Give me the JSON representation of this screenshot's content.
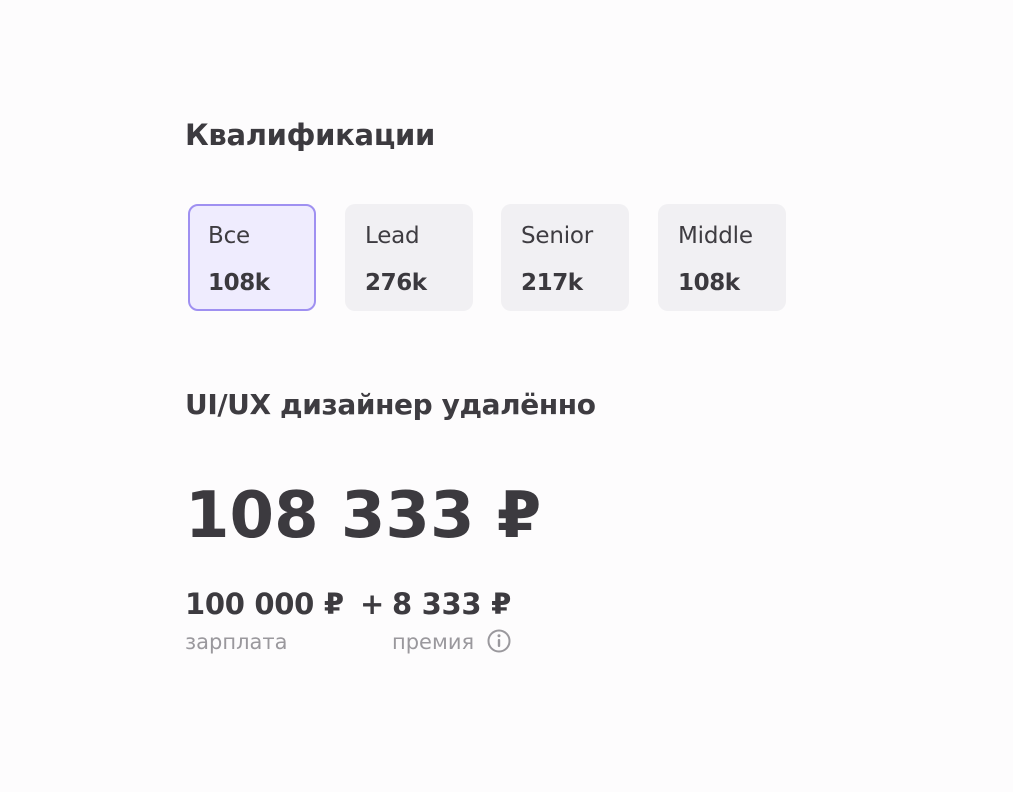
{
  "qualifications": {
    "title": "Квалификации",
    "tabs": [
      {
        "label": "Все",
        "value": "108k",
        "active": true
      },
      {
        "label": "Lead",
        "value": "276k",
        "active": false
      },
      {
        "label": "Senior",
        "value": "217k",
        "active": false
      },
      {
        "label": "Middle",
        "value": "108k",
        "active": false
      }
    ]
  },
  "job": {
    "title": "UI/UX дизайнер удалённо",
    "total": "108 333 ₽",
    "salary_amount": "100 000 ₽",
    "plus": "+",
    "bonus_amount": "8 333 ₽",
    "salary_label": "зарплата",
    "bonus_label": "премия"
  },
  "icons": {
    "info": "info-icon"
  },
  "colors": {
    "accent_border": "#9f90f1",
    "accent_background": "#efecfe",
    "tab_background": "#f1f0f3",
    "text_primary": "#3c3a3f",
    "text_muted": "#9a989d"
  }
}
